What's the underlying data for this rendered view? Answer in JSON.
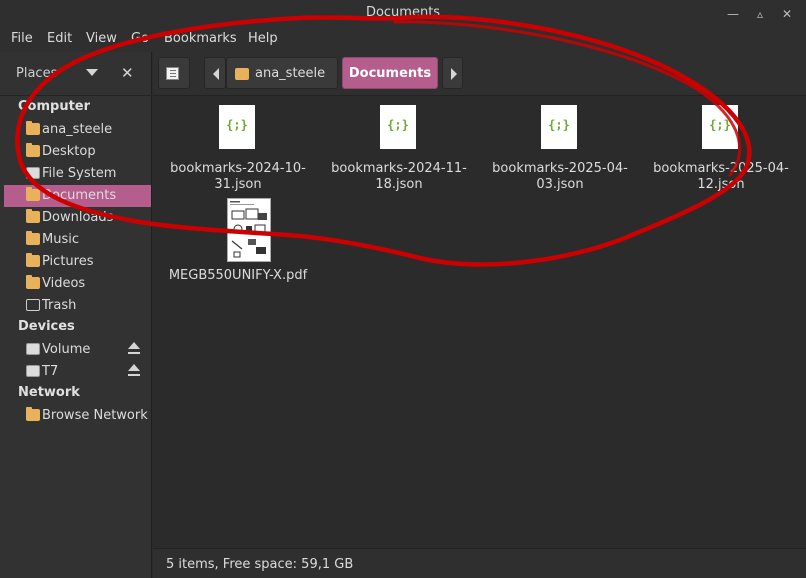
{
  "window": {
    "title": "Documents"
  },
  "menu": [
    "File",
    "Edit",
    "View",
    "Go",
    "Bookmarks",
    "Help"
  ],
  "sidebar": {
    "dropdown_label": "Places",
    "sections": {
      "computer": "Computer",
      "devices": "Devices",
      "network": "Network"
    },
    "computer_items": [
      "ana_steele",
      "Desktop",
      "File System",
      "Documents",
      "Downloads",
      "Music",
      "Pictures",
      "Videos",
      "Trash"
    ],
    "active_item": "Documents",
    "device_items": [
      "Volume",
      "T7"
    ],
    "network_items": [
      "Browse Network"
    ]
  },
  "breadcrumb": {
    "home": "ana_steele",
    "current": "Documents"
  },
  "files": [
    {
      "name": "bookmarks-2024-10-31.json",
      "line1": "bookmarks-2024-10-",
      "line2": "31.json",
      "icon": "json-file-icon",
      "glyph": "{;}"
    },
    {
      "name": "bookmarks-2024-11-18.json",
      "line1": "bookmarks-2024-11-",
      "line2": "18.json",
      "icon": "json-file-icon",
      "glyph": "{;}"
    },
    {
      "name": "bookmarks-2025-04-03.json",
      "line1": "bookmarks-2025-04-",
      "line2": "03.json",
      "icon": "json-file-icon",
      "glyph": "{;}"
    },
    {
      "name": "bookmarks-2025-04-12.json",
      "line1": "bookmarks-2025-04-",
      "line2": "12.json",
      "icon": "json-file-icon",
      "glyph": "{;}"
    },
    {
      "name": "MEGB550UNIFY-X.pdf",
      "line1": "MEGB550UNIFY-X.pdf",
      "line2": "",
      "icon": "pdf-file-icon"
    }
  ],
  "status": {
    "text": "5 items, Free space: 59,1 GB"
  },
  "colors": {
    "accent": "#b55e8e",
    "folder": "#e8b25c",
    "annotation": "#cc0000"
  }
}
